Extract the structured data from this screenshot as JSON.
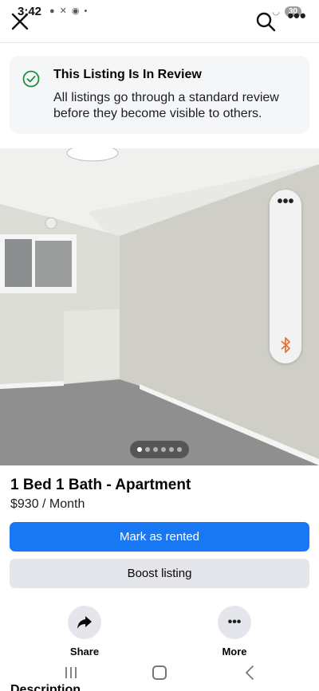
{
  "status_bar": {
    "time": "3:42",
    "battery": "30",
    "notification_icons": [
      "message-icon",
      "x-icon",
      "chrome-icon",
      "dot-icon"
    ]
  },
  "top_nav": {
    "icons": [
      "close-icon",
      "search-icon",
      "more-icon"
    ]
  },
  "review_banner": {
    "title": "This Listing Is In Review",
    "body": "All listings go through a standard review before they become visible to others.",
    "icon": "check-circle-icon",
    "accent_color": "#1e8e3e"
  },
  "photo": {
    "current_index": 1,
    "total": 6,
    "overlay_icons": [
      "more-icon",
      "bluetooth-icon"
    ]
  },
  "listing": {
    "title": "1 Bed 1 Bath - Apartment",
    "price": "$930 / Month"
  },
  "buttons": {
    "mark_rented": "Mark as rented",
    "boost": "Boost listing",
    "primary_color": "#1877f2"
  },
  "actions": {
    "share": "Share",
    "more": "More"
  },
  "section": {
    "description_heading": "Description"
  }
}
